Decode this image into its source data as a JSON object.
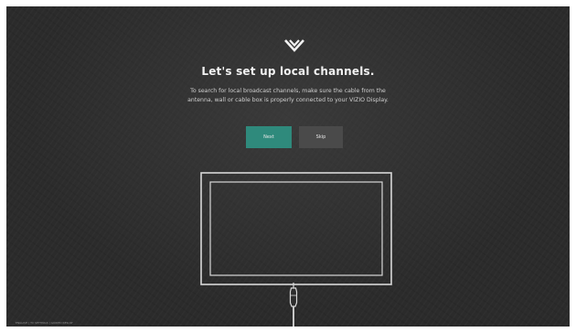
{
  "setup": {
    "logo_icon": "vizio-v-logo-icon",
    "title": "Let's set up local channels.",
    "description_line1": "To search for local broadcast channels, make sure the cable from the",
    "description_line2": "antenna, wall or cable box is properly connected to your VIZIO Display.",
    "next_label": "Next",
    "skip_label": "Skip"
  },
  "illustration": {
    "tv_icon": "tv-outline-icon",
    "cable_icon": "coax-cable-icon"
  },
  "footer": {
    "text": "ENGLISH | TV SETTINGS | GUIDED RESULT"
  },
  "colors": {
    "background": "#2b2b2b",
    "next_button": "#2f8a7c",
    "skip_button": "#4a4a4a",
    "text": "#f2f2f2"
  }
}
